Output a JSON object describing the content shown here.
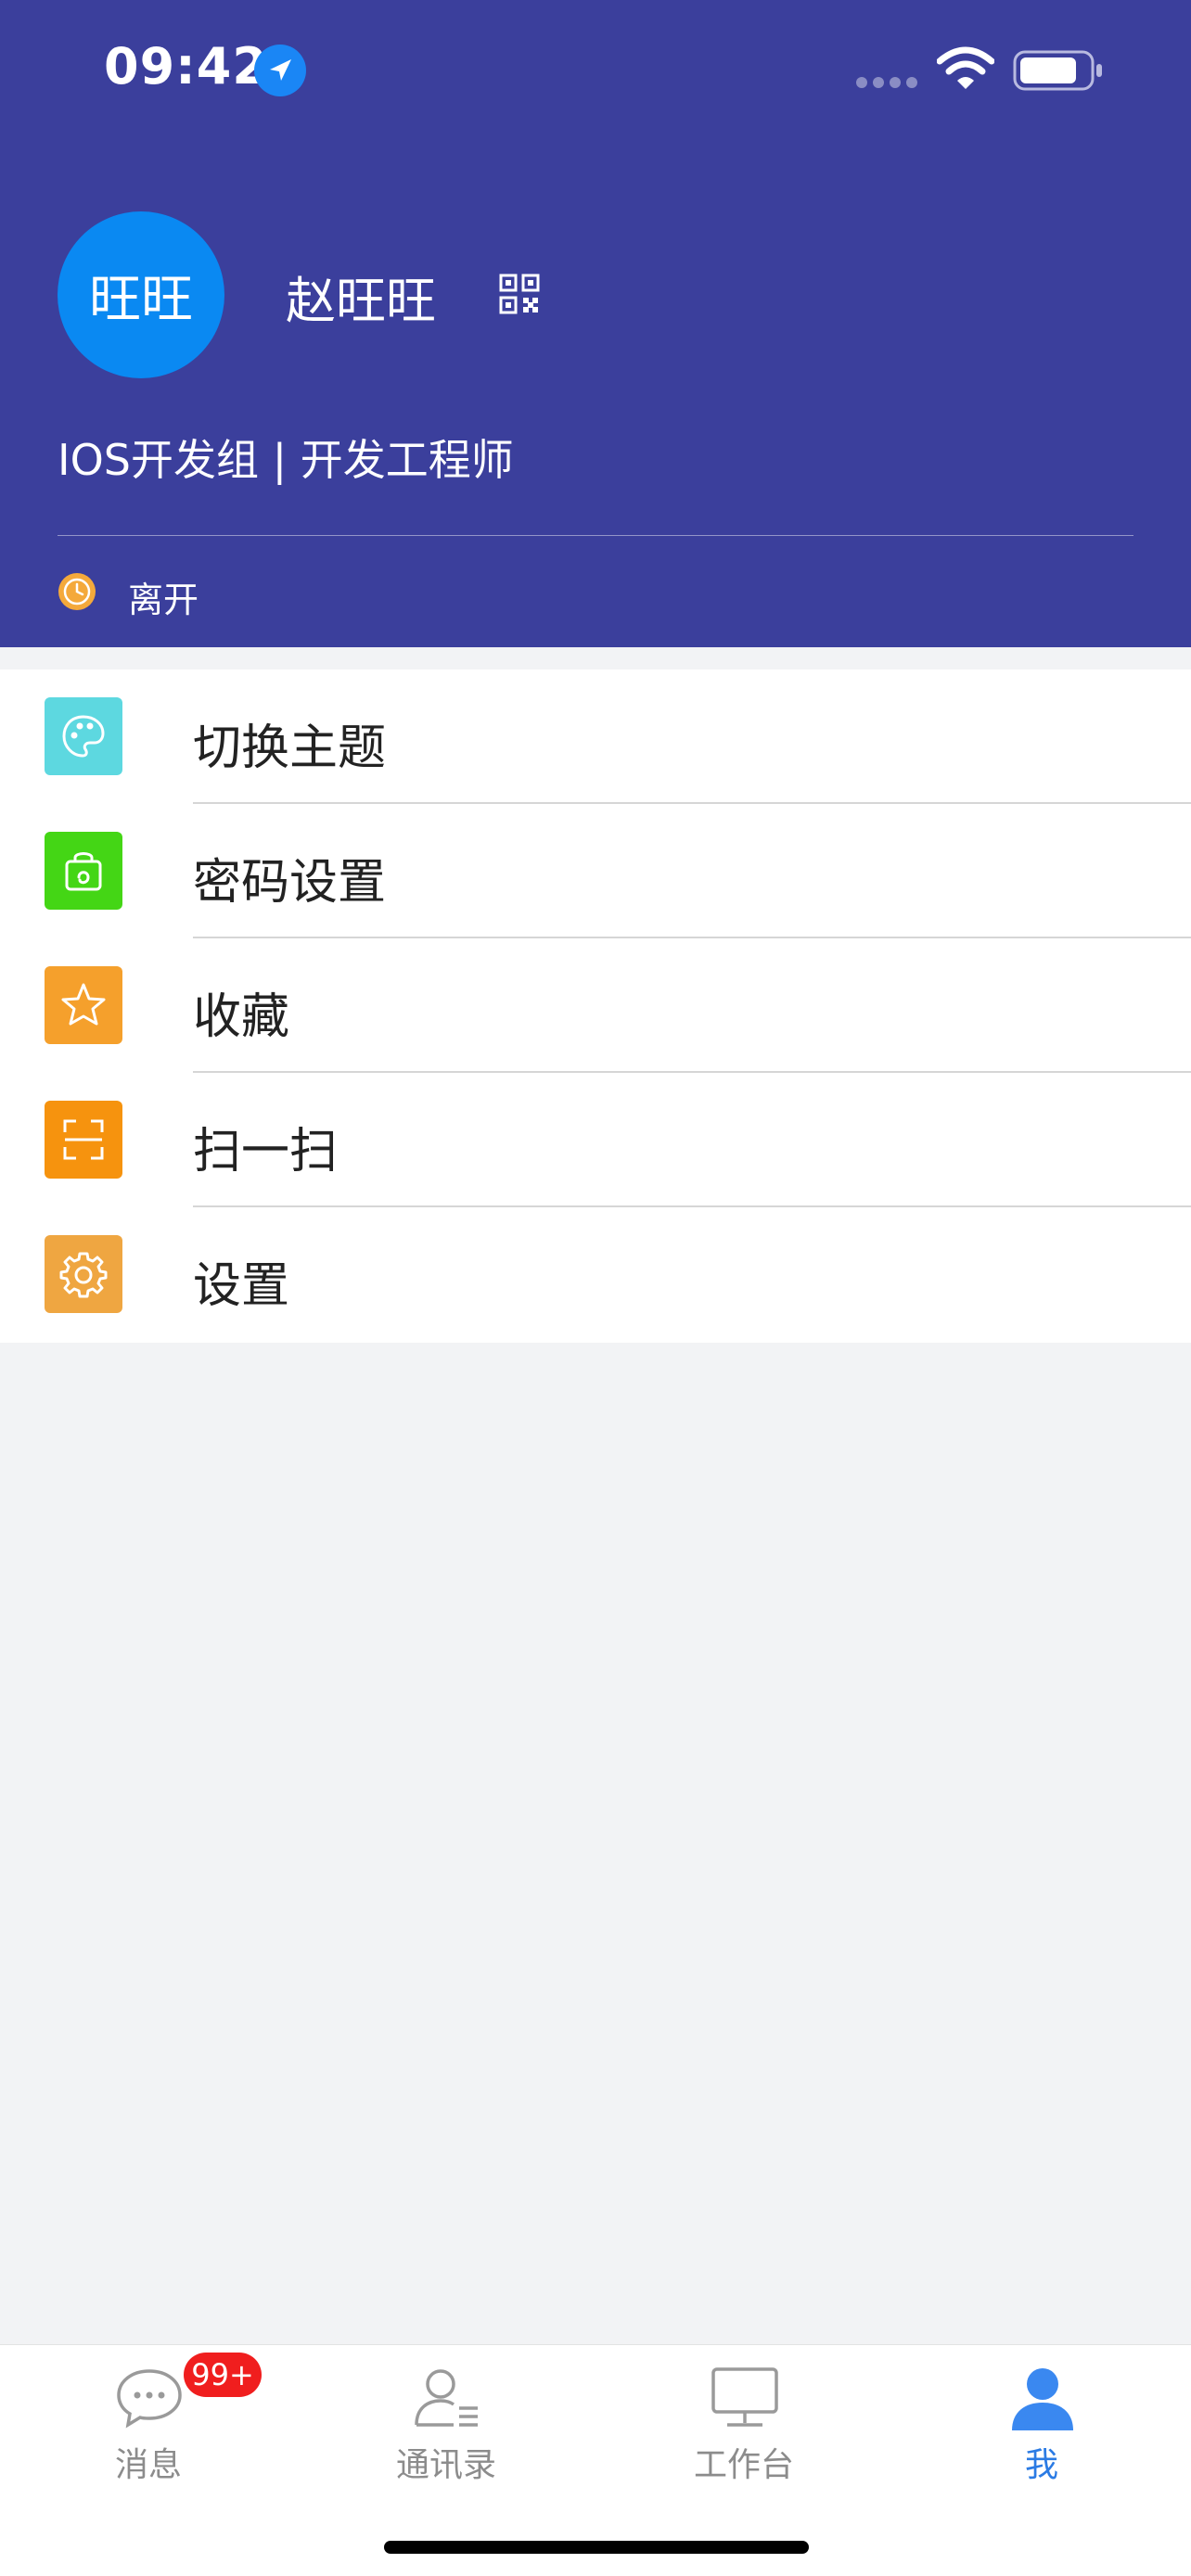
{
  "status_bar": {
    "time": "09:42",
    "icons": [
      "location-arrow-icon",
      "cellular-signal-icon",
      "wifi-icon",
      "battery-icon"
    ]
  },
  "profile": {
    "avatar_text": "旺旺",
    "name": "赵旺旺",
    "department": "IOS开发组 | 开发工程师",
    "status": "离开",
    "status_icon": "clock-icon",
    "qr_icon": "qr-code-icon"
  },
  "menu": {
    "items": [
      {
        "label": "切换主题",
        "icon": "palette-icon",
        "color": "#5dd8e0"
      },
      {
        "label": "密码设置",
        "icon": "lock-bag-icon",
        "color": "#44d615"
      },
      {
        "label": "收藏",
        "icon": "star-icon",
        "color": "#f5a02c"
      },
      {
        "label": "扫一扫",
        "icon": "scan-icon",
        "color": "#f6930e"
      },
      {
        "label": "设置",
        "icon": "gear-icon",
        "color": "#efa641"
      }
    ]
  },
  "tab_bar": {
    "tabs": [
      {
        "label": "消息",
        "icon": "chat-bubble-icon",
        "badge": "99+",
        "active": false
      },
      {
        "label": "通讯录",
        "icon": "contacts-icon",
        "active": false
      },
      {
        "label": "工作台",
        "icon": "monitor-icon",
        "active": false
      },
      {
        "label": "我",
        "icon": "person-icon",
        "active": true
      }
    ]
  },
  "colors": {
    "header_bg": "#3b3f9c",
    "avatar_bg": "#0a89f2",
    "active_tab": "#2b7be4",
    "badge": "#f01e1e",
    "page_bg": "#f2f3f5"
  }
}
